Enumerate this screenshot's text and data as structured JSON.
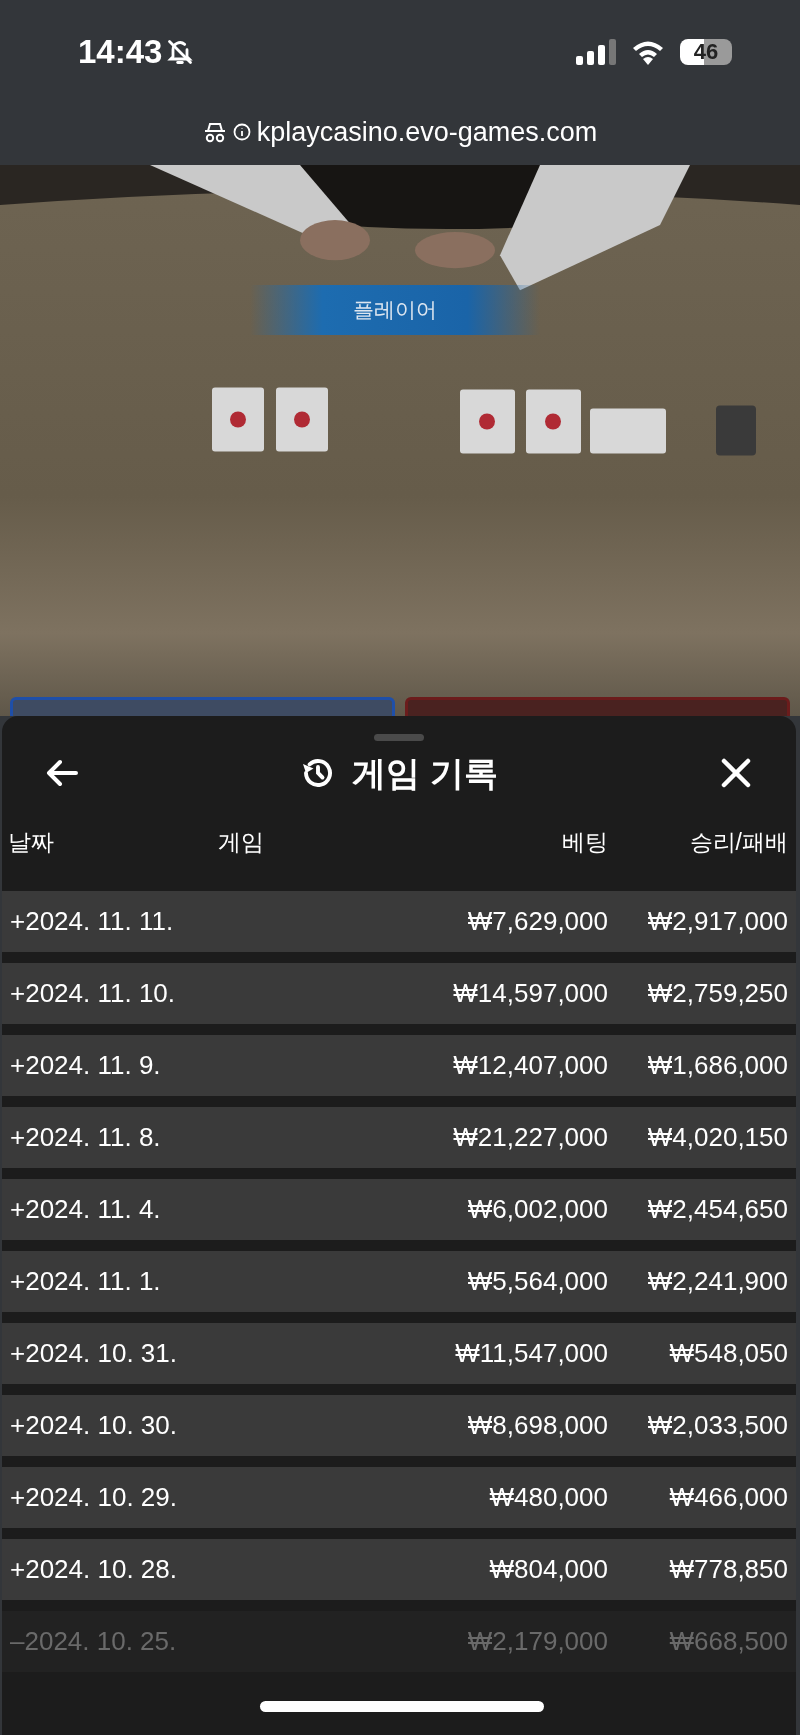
{
  "status_bar": {
    "time": "14:43",
    "silent": true,
    "battery": "46"
  },
  "browser": {
    "url": "kplaycasino.evo-games.com",
    "private": true
  },
  "video": {
    "kind": "picture",
    "banner": "플레이어"
  },
  "bet_spots": [
    {
      "color": "#1f4fa8"
    },
    {
      "color": "#6b1c1c"
    }
  ],
  "sheet": {
    "title": "게임 기록",
    "columns": [
      "날짜",
      "게임",
      "베팅",
      "승리/패배"
    ],
    "rows": [
      {
        "date": "+2024. 11. 11.",
        "bet": "₩7,629,000",
        "result": "₩2,917,000",
        "faded": false
      },
      {
        "date": "+2024. 11. 10.",
        "bet": "₩14,597,000",
        "result": "₩2,759,250",
        "faded": false
      },
      {
        "date": "+2024. 11. 9.",
        "bet": "₩12,407,000",
        "result": "₩1,686,000",
        "faded": false
      },
      {
        "date": "+2024. 11. 8.",
        "bet": "₩21,227,000",
        "result": "₩4,020,150",
        "faded": false
      },
      {
        "date": "+2024. 11. 4.",
        "bet": "₩6,002,000",
        "result": "₩2,454,650",
        "faded": false
      },
      {
        "date": "+2024. 11. 1.",
        "bet": "₩5,564,000",
        "result": "₩2,241,900",
        "faded": false
      },
      {
        "date": "+2024. 10. 31.",
        "bet": "₩11,547,000",
        "result": "₩548,050",
        "faded": false
      },
      {
        "date": "+2024. 10. 30.",
        "bet": "₩8,698,000",
        "result": "₩2,033,500",
        "faded": false
      },
      {
        "date": "+2024. 10. 29.",
        "bet": "₩480,000",
        "result": "₩466,000",
        "faded": false
      },
      {
        "date": "+2024. 10. 28.",
        "bet": "₩804,000",
        "result": "₩778,850",
        "faded": false
      },
      {
        "date": "–2024. 10. 25.",
        "bet": "₩2,179,000",
        "result": "₩668,500",
        "faded": true
      }
    ]
  }
}
